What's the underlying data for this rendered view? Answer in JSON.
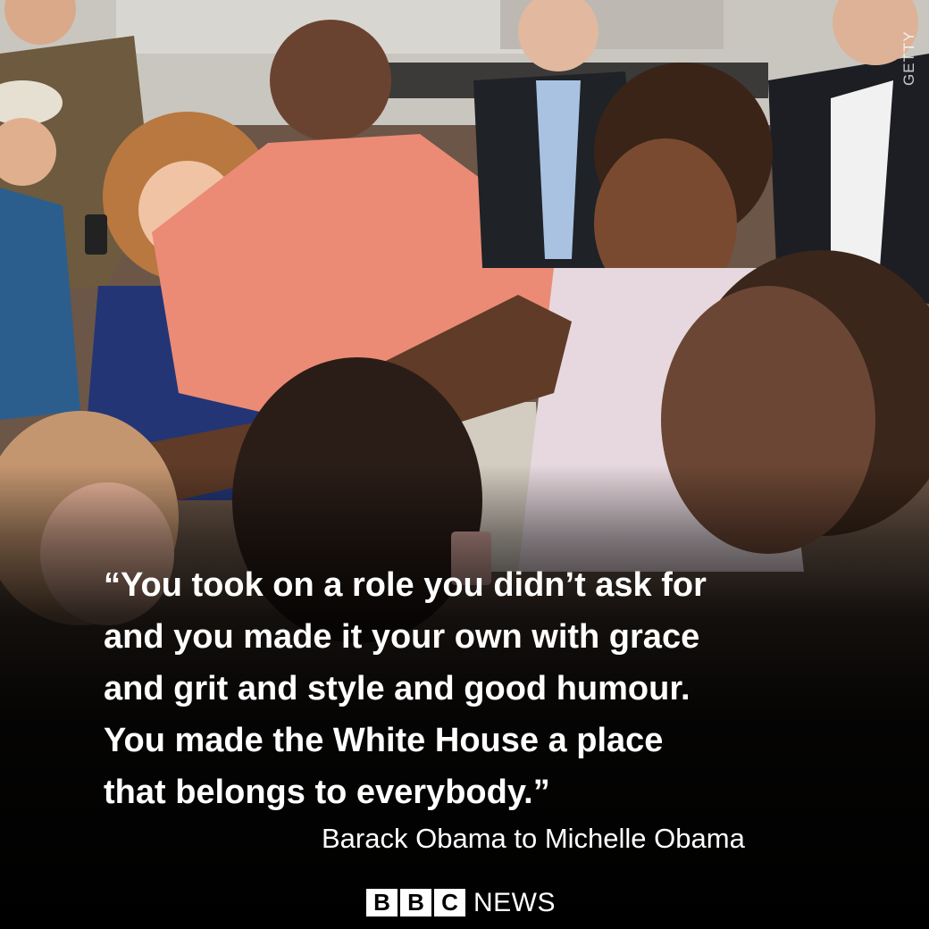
{
  "photo_credit": "GETTY",
  "quote": {
    "lines": [
      "“You took on a role you didn’t ask for",
      "and you made it your own with grace",
      "and grit and style and good humour.",
      "You made the White House a place",
      "that belongs to everybody.”"
    ]
  },
  "attribution": "Barack Obama to Michelle Obama",
  "logo": {
    "blocks": [
      "B",
      "B",
      "C"
    ],
    "word": "NEWS"
  },
  "colors": {
    "text": "#ffffff",
    "background": "#000000"
  }
}
